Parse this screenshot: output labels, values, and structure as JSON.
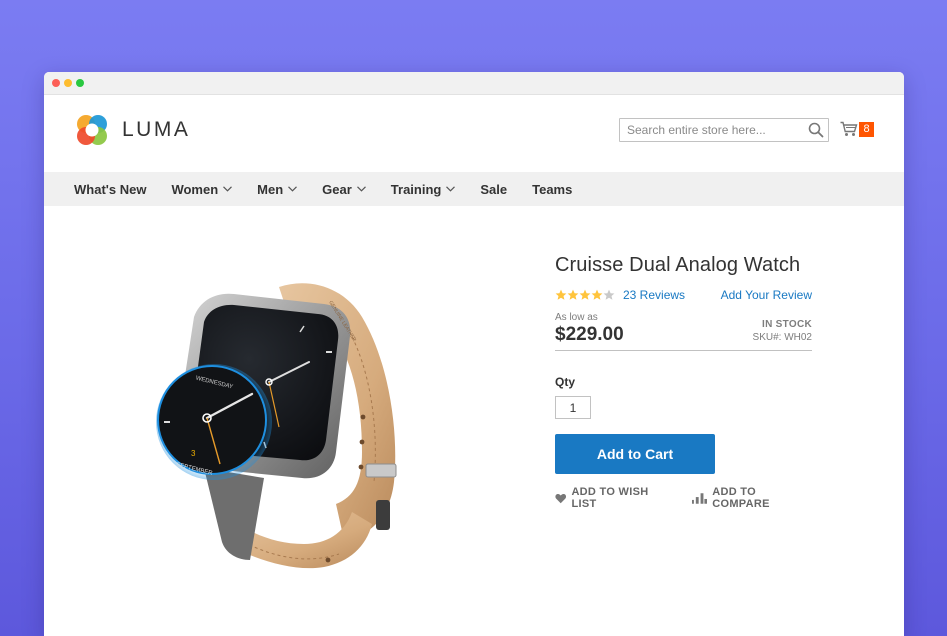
{
  "header": {
    "brand": "LUMA",
    "search_placeholder": "Search entire store here...",
    "cart_count": "8",
    "icons": {
      "logo": "luma-logo-icon",
      "search": "search-icon",
      "cart": "cart-icon"
    }
  },
  "nav": {
    "items": [
      {
        "label": "What's New",
        "dropdown": false
      },
      {
        "label": "Women",
        "dropdown": true
      },
      {
        "label": "Men",
        "dropdown": true
      },
      {
        "label": "Gear",
        "dropdown": true
      },
      {
        "label": "Training",
        "dropdown": true
      },
      {
        "label": "Sale",
        "dropdown": false
      },
      {
        "label": "Teams",
        "dropdown": false
      }
    ]
  },
  "product": {
    "title": "Cruisse Dual Analog Watch",
    "rating": 4,
    "rating_max": 5,
    "reviews_label": "23 Reviews",
    "add_review_label": "Add Your Review",
    "price_prefix": "As low as",
    "price": "$229.00",
    "stock": "IN STOCK",
    "sku": "SKU#: WH02",
    "qty_label": "Qty",
    "qty_value": "1",
    "add_to_cart_label": "Add to Cart",
    "wish_list_label": "ADD TO WISH LIST",
    "compare_label": "ADD TO COMPARE",
    "watch_face": {
      "day": "WEDNESDAY",
      "date": "3",
      "month": "SEPTEMBER",
      "strap_text": "GENUINE LEATHER"
    }
  },
  "colors": {
    "accent": "#1979c3",
    "cart_badge": "#ff5501",
    "star_filled": "#ffc43c",
    "nav_bg": "#f0f0f0",
    "background": "#6b6ae8"
  }
}
